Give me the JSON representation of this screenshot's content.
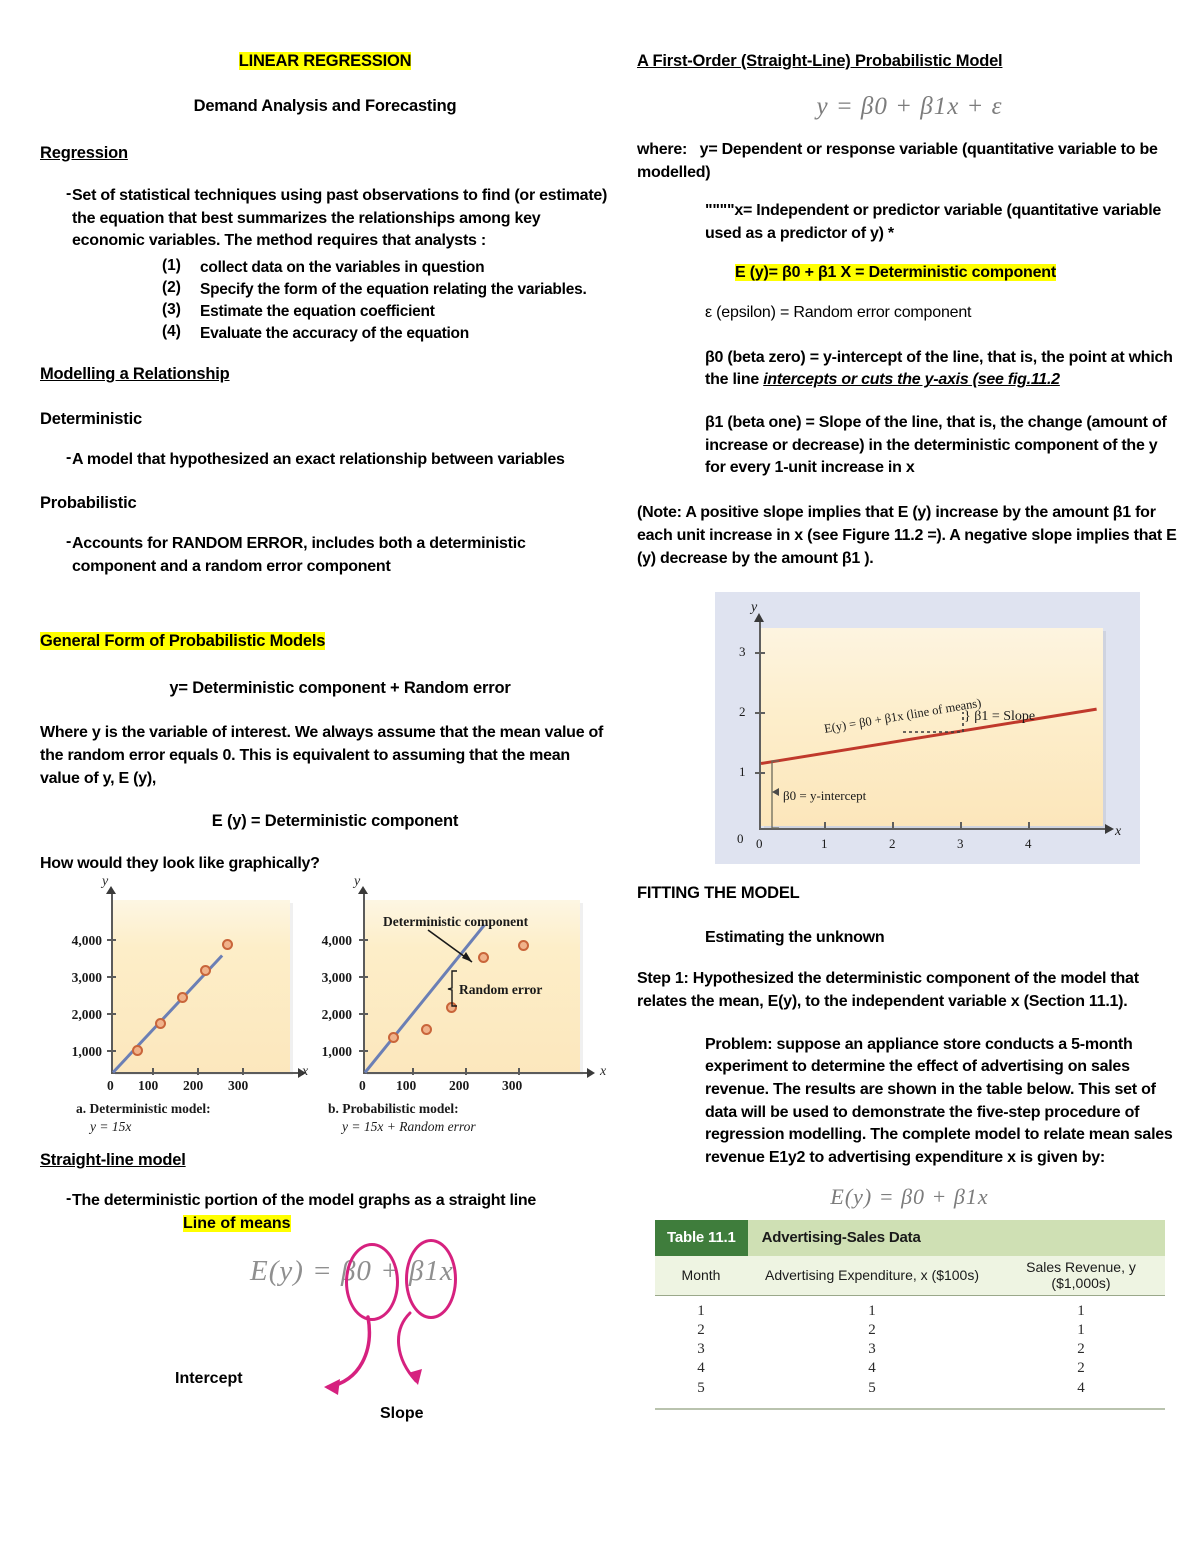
{
  "left": {
    "title": "LINEAR REGRESSION",
    "subtitle": "Demand Analysis and Forecasting",
    "regression_heading": "Regression",
    "regression_bullet": "Set of statistical techniques using past observations to find (or estimate) the equation that best summarizes the relationships among key economic variables. The method requires that analysts :",
    "steps": [
      {
        "num": "(1)",
        "text": "collect data on the variables in question"
      },
      {
        "num": "(2)",
        "text": "Specify the form of the equation relating the variables."
      },
      {
        "num": "(3)",
        "text": "Estimate the equation coefficient"
      },
      {
        "num": "(4)",
        "text": "Evaluate the accuracy of the equation"
      }
    ],
    "modelling_heading": "Modelling a Relationship",
    "deterministic_heading": "Deterministic",
    "deterministic_bullet": "A model that hypothesized an exact relationship between variables",
    "probabilistic_heading": "Probabilistic",
    "probabilistic_bullet": "Accounts for RANDOM ERROR, includes both a deterministic component and a random error component",
    "general_form_heading": "General Form of Probabilistic Models",
    "general_form_equation": "y= Deterministic component + Random error",
    "where_paragraph": "Where y is the variable of interest. We always assume that the mean value of the random error equals 0. This is equivalent to assuming that the mean value of y, E (y),",
    "ey_equation": "E (y) = Deterministic component",
    "graphically_question": "How would they look like graphically?",
    "straight_line_heading": "Straight-line model",
    "straight_line_bullet": "The deterministic portion of the model graphs as a straight line",
    "line_of_means_label": "Line of means",
    "intercept_label": "Intercept",
    "slope_label": "Slope"
  },
  "right": {
    "first_order_heading": "A First-Order (Straight-Line) Probabilistic Model",
    "where_label": "where:",
    "y_definition": "y= Dependent or response variable (quantitative variable to be modelled)",
    "x_definition": "\"\"\"\"x= Independent or predictor variable        (quantitative variable used as a predictor of y) *",
    "deterministic_highlight": "E (y)= β0 + β1 X  = Deterministic component",
    "epsilon_definition": "ε (epsilon) = Random error component",
    "beta0_definition_a": "β0 (beta zero) = y-intercept of the line, that is, the point at which the line ",
    "beta0_definition_b": "intercepts or cuts the y-axis (see fig.11.2",
    "beta1_definition": "β1 (beta one) = Slope of the line, that is, the change (amount of increase or decrease) in the deterministic component of the y for every 1-unit increase in x",
    "note_paragraph": "(Note: A positive slope implies that E (y) increase by the amount β1 for each unit increase in x (see Figure 11.2 =). A negative slope implies that E (y) decrease by the amount β1 ).",
    "fitting_heading": "FITTING THE MODEL",
    "estimating_heading": "Estimating the unknown",
    "step1": "Step 1: Hypothesized the deterministic component of the model that relates the mean, E(y), to the independent variable x (Section 11.1).",
    "problem": "Problem: suppose an appliance store conducts a 5-month experiment to determine the effect of advertising on sales revenue. The results are shown in the table below. This set of data will be used to demonstrate the five-step procedure of regression modelling. The complete model to relate mean sales revenue E1y2 to advertising expenditure x is given by:"
  },
  "chart_data": [
    {
      "type": "scatter",
      "id": "deterministic-model-chart",
      "title": "a. Deterministic model:",
      "subtitle": "y = 15x",
      "xlabel": "x",
      "ylabel": "y",
      "xticks": [
        "0",
        "100",
        "200",
        "300"
      ],
      "yticks": [
        "1,000",
        "2,000",
        "3,000",
        "4,000"
      ],
      "xlim": [
        0,
        380
      ],
      "ylim": [
        0,
        4800
      ],
      "grid": false,
      "points": [
        {
          "x": 50,
          "y": 750
        },
        {
          "x": 100,
          "y": 1500
        },
        {
          "x": 150,
          "y": 2250
        },
        {
          "x": 200,
          "y": 3000
        },
        {
          "x": 250,
          "y": 3750
        }
      ],
      "line": {
        "slope": 15,
        "intercept": 0,
        "label": "y = 15x"
      }
    },
    {
      "type": "scatter",
      "id": "probabilistic-model-chart",
      "title": "b. Probabilistic model:",
      "subtitle": "y = 15x + Random error",
      "xlabel": "x",
      "ylabel": "y",
      "xticks": [
        "0",
        "100",
        "200",
        "300"
      ],
      "yticks": [
        "1,000",
        "2,000",
        "3,000",
        "4,000"
      ],
      "xlim": [
        0,
        380
      ],
      "ylim": [
        0,
        4800
      ],
      "grid": false,
      "annotations": [
        "Deterministic component",
        "Random error"
      ],
      "points": [
        {
          "x": 50,
          "y": 1050
        },
        {
          "x": 110,
          "y": 1300
        },
        {
          "x": 160,
          "y": 1900
        },
        {
          "x": 215,
          "y": 3300
        },
        {
          "x": 290,
          "y": 3600
        }
      ],
      "line": {
        "slope": 15,
        "intercept": 0,
        "label": "y = 15x + Random error"
      }
    },
    {
      "type": "line",
      "id": "line-of-means-chart",
      "title": "",
      "xlabel": "x",
      "ylabel": "y",
      "xticks": [
        "0",
        "1",
        "2",
        "3",
        "4"
      ],
      "yticks": [
        "0",
        "1",
        "2",
        "3"
      ],
      "xlim": [
        0,
        5
      ],
      "ylim": [
        0,
        3.6
      ],
      "grid": false,
      "line_label": "E(y) = β0 + β1x (line of means)",
      "slope_label": "} β1 = Slope",
      "intercept_label": "β0 = y-intercept",
      "intercept": 1.17,
      "slope": 0.37
    },
    {
      "type": "table",
      "id": "advertising-sales-data",
      "table_number": "Table 11.1",
      "table_title": "Advertising-Sales Data",
      "columns": [
        "Month",
        "Advertising Expenditure, x ($100s)",
        "Sales Revenue, y ($1,000s)"
      ],
      "rows": [
        [
          "1",
          "1",
          "1"
        ],
        [
          "2",
          "2",
          "1"
        ],
        [
          "3",
          "3",
          "2"
        ],
        [
          "4",
          "4",
          "2"
        ],
        [
          "5",
          "5",
          "4"
        ]
      ]
    }
  ],
  "equations": {
    "first_order": "y = β0 + β1x + ε",
    "line_of_means": "E(y) = β0 + β1x",
    "model_relation": "E(y) = β0 + β1x"
  },
  "colors": {
    "highlight": "#ffff00",
    "pink_ink": "#d6217f",
    "figure_blue_bg": "#dfe3f0",
    "figure_cream_bg": "#fdeec8",
    "red_line": "#c0392b",
    "blue_line": "#6b7fb5",
    "dot_fill": "#f0b28a",
    "dot_stroke": "#c9653a",
    "table_green_dark": "#3f7d3c",
    "table_green_light": "#cfe0b4"
  }
}
